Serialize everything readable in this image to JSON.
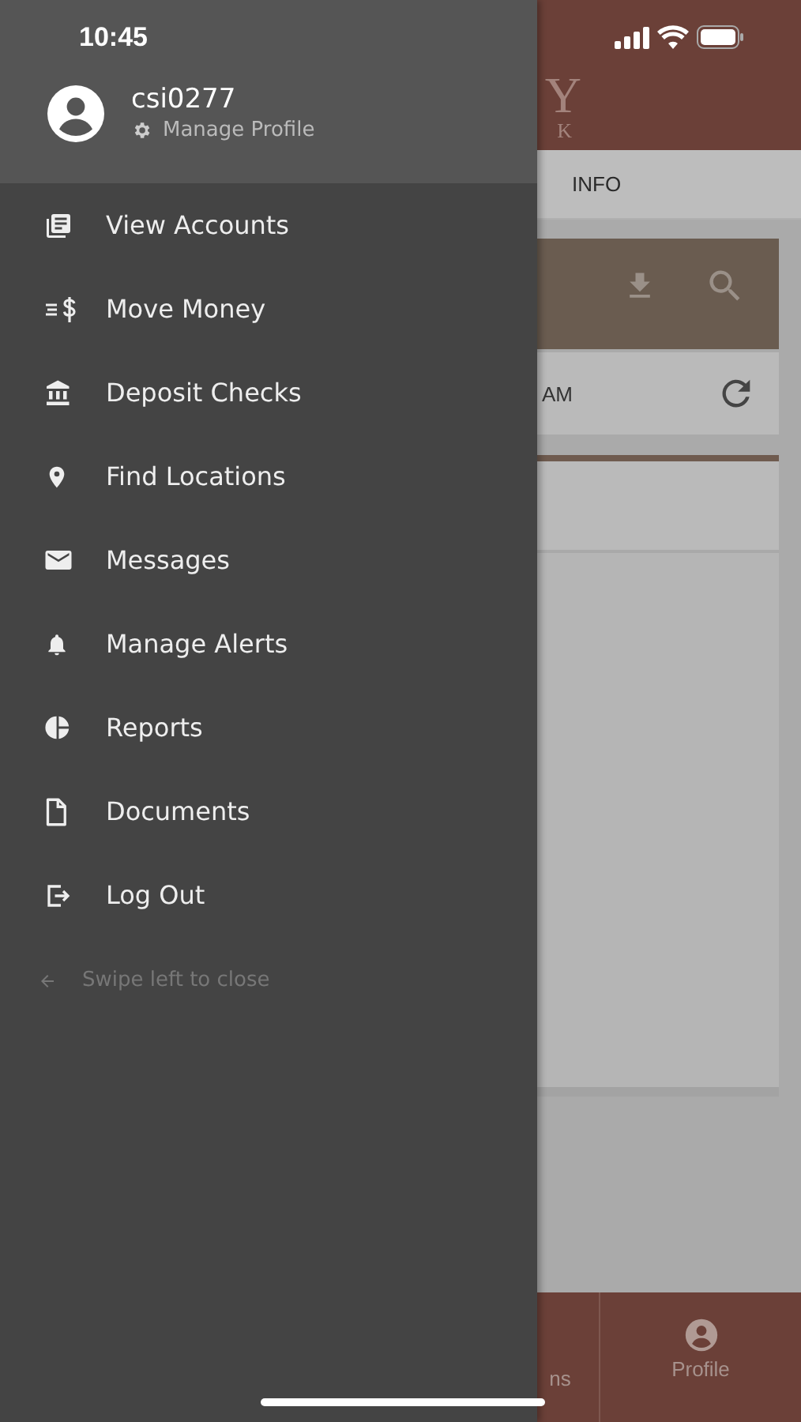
{
  "status_bar": {
    "time": "10:45"
  },
  "drawer": {
    "username": "csi0277",
    "manage_profile": "Manage Profile",
    "items": [
      {
        "kind": "accounts",
        "label": "View Accounts"
      },
      {
        "kind": "money",
        "label": "Move Money"
      },
      {
        "kind": "bank",
        "label": "Deposit Checks"
      },
      {
        "kind": "pin",
        "label": "Find Locations"
      },
      {
        "kind": "mail",
        "label": "Messages"
      },
      {
        "kind": "bell",
        "label": "Manage Alerts"
      },
      {
        "kind": "chart",
        "label": "Reports"
      },
      {
        "kind": "doc",
        "label": "Documents"
      },
      {
        "kind": "logout",
        "label": "Log Out"
      }
    ],
    "hint": "Swipe left to close"
  },
  "background": {
    "logo_text": "Y",
    "logo_subtext": "K",
    "tab": "INFO",
    "time_text": "AM",
    "nav": [
      {
        "label": "ns",
        "kind": "plain"
      },
      {
        "label": "Profile",
        "kind": "profile"
      }
    ]
  }
}
